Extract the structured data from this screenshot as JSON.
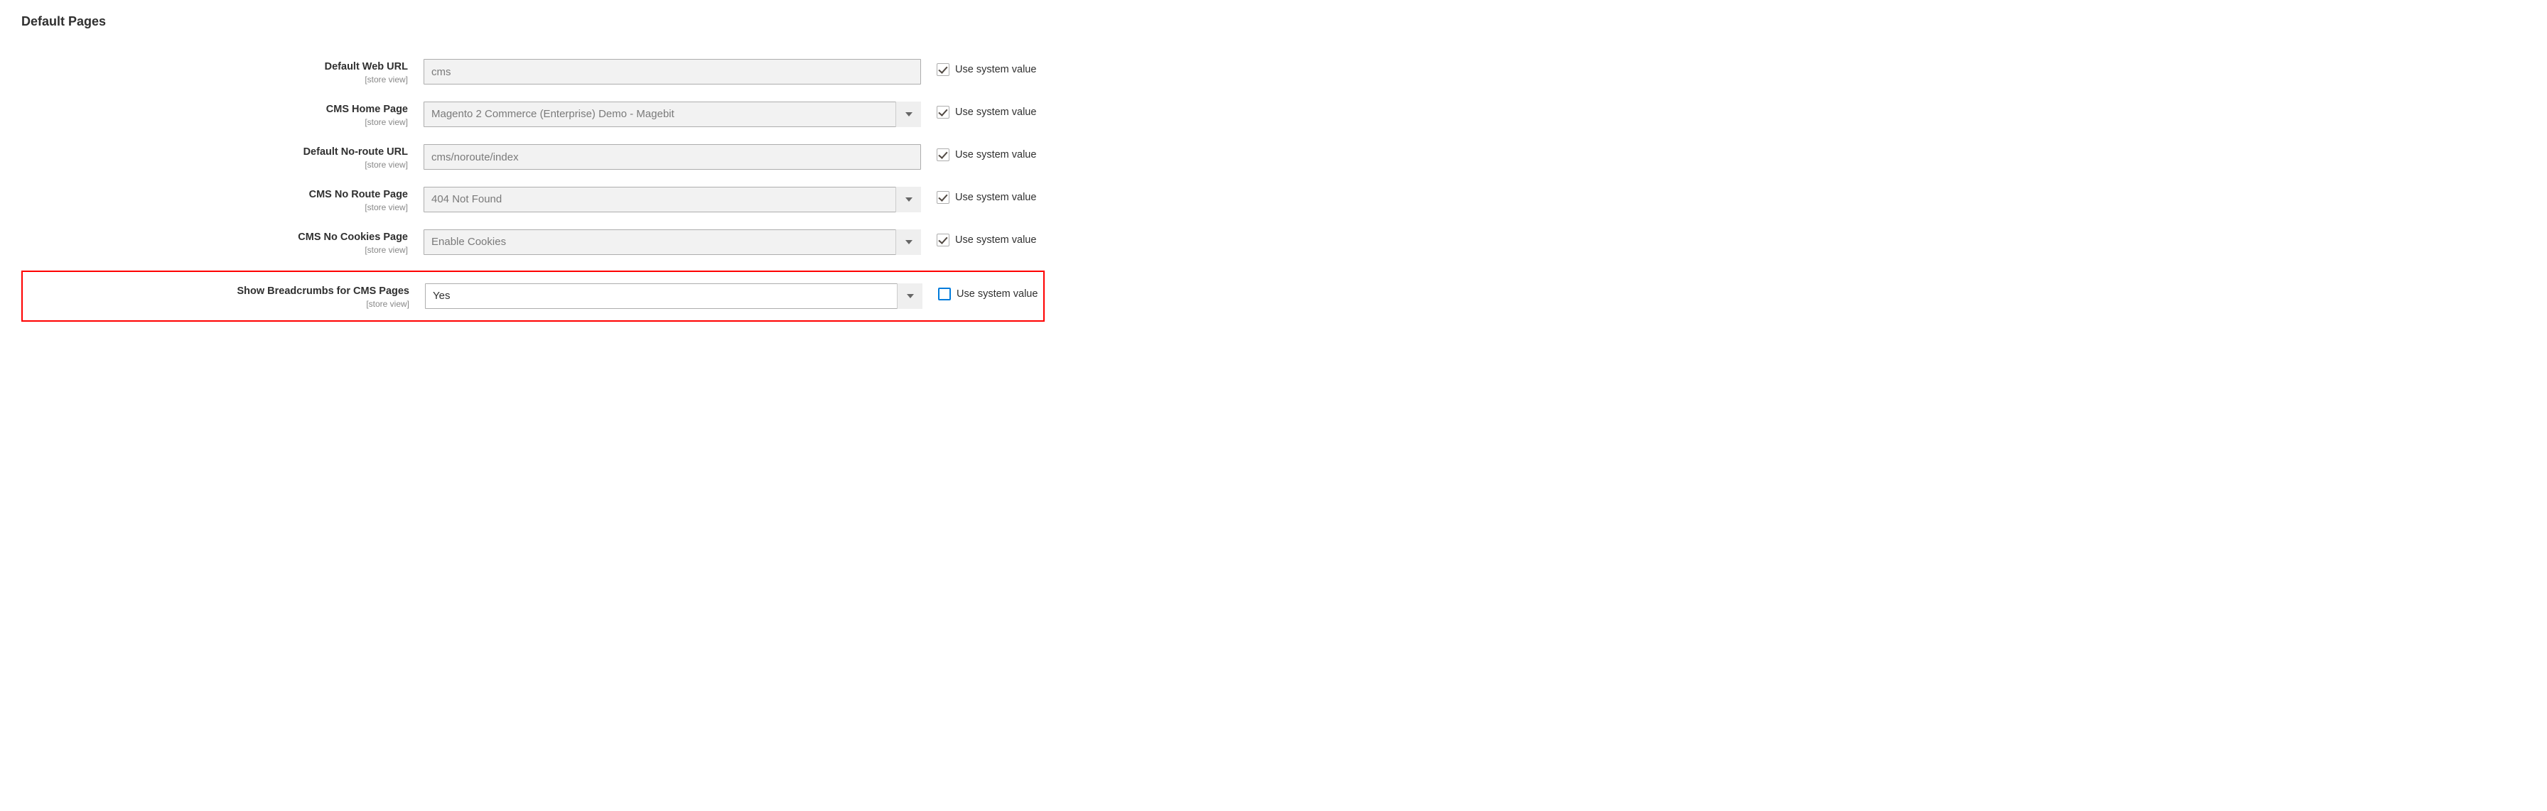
{
  "section_title": "Default Pages",
  "scope_label": "[store view]",
  "use_system_value_label": "Use system value",
  "fields": {
    "default_web_url": {
      "label": "Default Web URL",
      "value": "cms",
      "use_system": true,
      "type": "text"
    },
    "cms_home_page": {
      "label": "CMS Home Page",
      "value": "Magento 2 Commerce (Enterprise) Demo - Magebit",
      "use_system": true,
      "type": "select"
    },
    "default_no_route_url": {
      "label": "Default No-route URL",
      "value": "cms/noroute/index",
      "use_system": true,
      "type": "text"
    },
    "cms_no_route_page": {
      "label": "CMS No Route Page",
      "value": "404 Not Found",
      "use_system": true,
      "type": "select"
    },
    "cms_no_cookies_page": {
      "label": "CMS No Cookies Page",
      "value": "Enable Cookies",
      "use_system": true,
      "type": "select"
    },
    "show_breadcrumbs": {
      "label": "Show Breadcrumbs for CMS Pages",
      "value": "Yes",
      "use_system": false,
      "type": "select"
    }
  }
}
